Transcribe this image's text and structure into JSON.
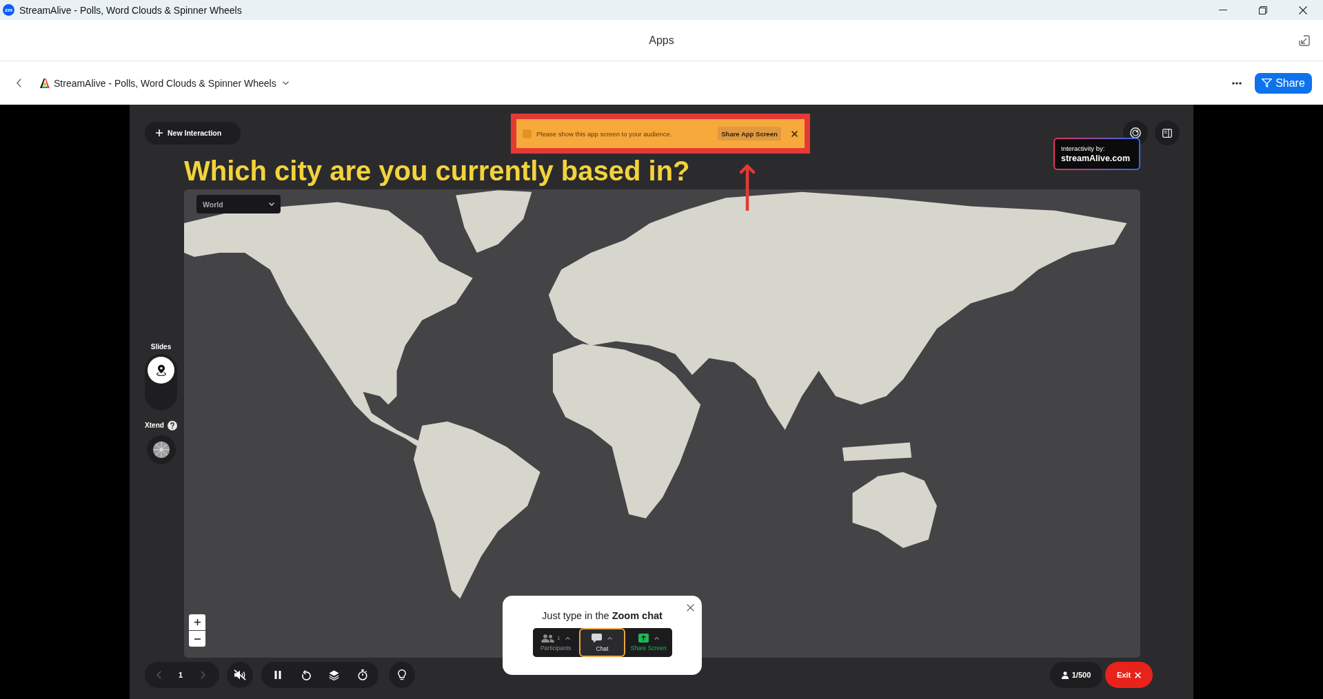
{
  "window": {
    "logo_text": "zm",
    "title": "StreamAlive - Polls, Word Clouds & Spinner Wheels"
  },
  "apps_bar": {
    "title": "Apps"
  },
  "header": {
    "app_name": "StreamAlive - Polls, Word Clouds & Spinner Wheels",
    "share_button": "Share"
  },
  "stage": {
    "new_interaction": "New Interaction",
    "question": "Which city are you currently based in?",
    "banner": {
      "message": "Please show this app screen to your audience.",
      "button": "Share App Screen"
    },
    "badge": {
      "caption": "Interactivity by:",
      "brand": "streamAlive.com"
    },
    "map": {
      "region": "World"
    },
    "rail": {
      "slides_label": "Slides",
      "slides": [
        {
          "kind": "map",
          "selected": true
        }
      ],
      "xtend_label": "Xtend"
    }
  },
  "bottom_bar": {
    "prev_disabled": true,
    "page": "1",
    "next_disabled": true,
    "muted": true,
    "audience": "1/500",
    "exit_button": "Exit"
  },
  "popup": {
    "text": "Just type in the **Zoom chat**",
    "toolbar": [
      {
        "kind": "participants",
        "label": "Participants",
        "count": "1",
        "selected": false
      },
      {
        "kind": "chat",
        "label": "Chat",
        "selected": true
      },
      {
        "kind": "share",
        "label": "Share Screen",
        "selected": false
      }
    ]
  }
}
